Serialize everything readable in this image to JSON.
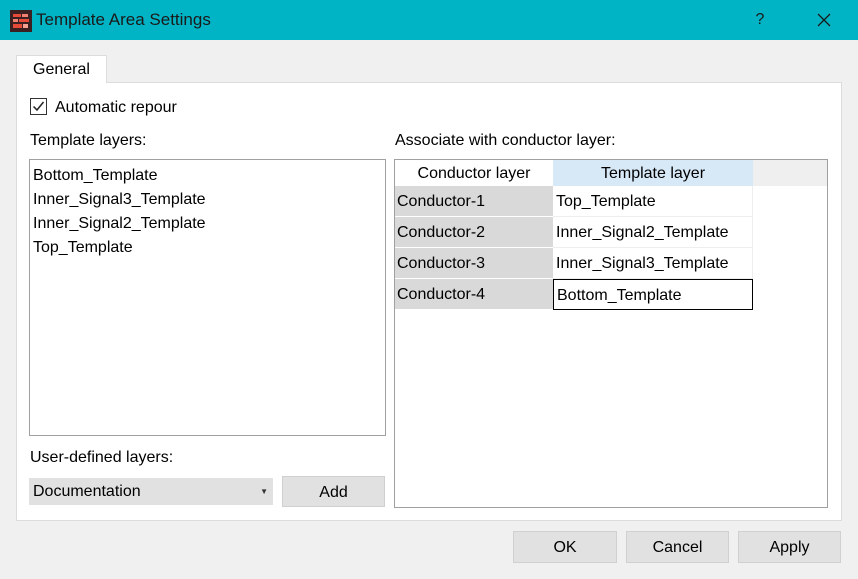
{
  "window": {
    "title": "Template Area Settings",
    "help_label": "?"
  },
  "tabs": [
    {
      "label": "General"
    }
  ],
  "general": {
    "automatic_repour": {
      "label": "Automatic repour",
      "checked": true
    },
    "template_layers": {
      "label": "Template layers:",
      "items": [
        "Bottom_Template",
        "Inner_Signal3_Template",
        "Inner_Signal2_Template",
        "Top_Template"
      ]
    },
    "user_defined_layers": {
      "label": "User-defined layers:",
      "selected": "Documentation",
      "add_label": "Add"
    },
    "associate": {
      "label": "Associate with conductor layer:",
      "columns": [
        "Conductor layer",
        "Template layer"
      ],
      "rows": [
        {
          "conductor": "Conductor-1",
          "template": "Top_Template"
        },
        {
          "conductor": "Conductor-2",
          "template": "Inner_Signal2_Template"
        },
        {
          "conductor": "Conductor-3",
          "template": "Inner_Signal3_Template"
        },
        {
          "conductor": "Conductor-4",
          "template": "Bottom_Template"
        }
      ]
    }
  },
  "footer": {
    "ok_label": "OK",
    "cancel_label": "Cancel",
    "apply_label": "Apply"
  },
  "colors": {
    "titlebar": "#00b4c5",
    "header_selected": "#d7e8f7",
    "row_header": "#d9d9d9"
  }
}
